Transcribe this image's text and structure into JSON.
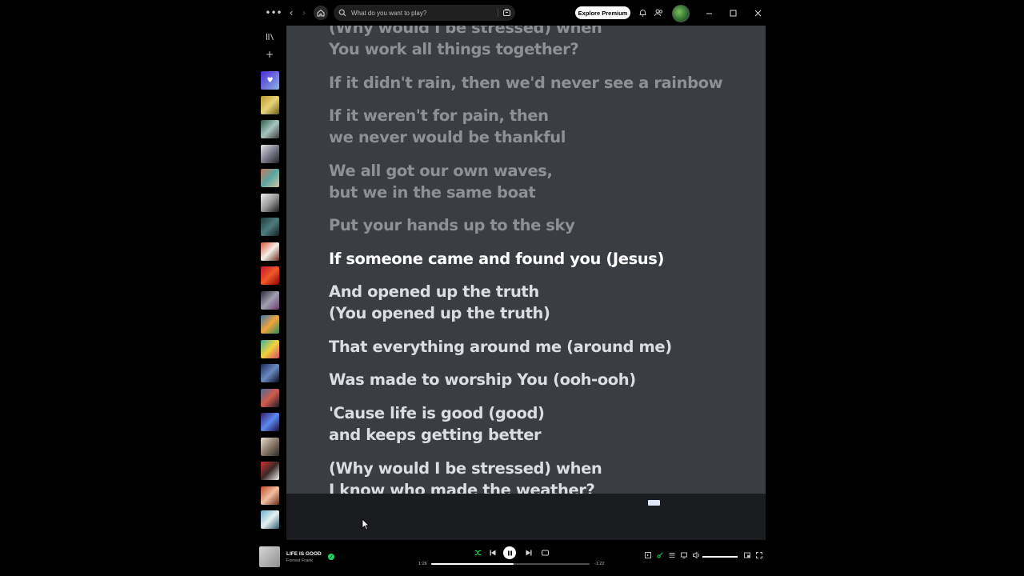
{
  "topbar": {
    "search_placeholder": "What do you want to play?",
    "premium_label": "Explore Premium"
  },
  "lyrics": {
    "lines": [
      {
        "text": "(Why would I be stressed) when",
        "state": "past"
      },
      {
        "text": "You work all things together?",
        "state": "past"
      },
      {
        "text": "If it didn't rain, then we'd never see a rainbow",
        "state": "past"
      },
      {
        "text": "If it weren't for pain, then",
        "state": "past"
      },
      {
        "text": "we never would be thankful",
        "state": "past"
      },
      {
        "text": "We all got our own waves,",
        "state": "past"
      },
      {
        "text": "but we in the same boat",
        "state": "past"
      },
      {
        "text": "Put your hands up to the sky",
        "state": "past"
      },
      {
        "text": "If someone came and found you (Jesus)",
        "state": "current"
      },
      {
        "text": "And opened up the truth",
        "state": "future"
      },
      {
        "text": "(You opened up the truth)",
        "state": "future"
      },
      {
        "text": "That everything around me (around me)",
        "state": "future"
      },
      {
        "text": "Was made to worship You (ooh-ooh)",
        "state": "future"
      },
      {
        "text": "'Cause life is good (good)",
        "state": "future"
      },
      {
        "text": "and keeps getting better",
        "state": "future"
      },
      {
        "text": "(Why would I be stressed) when",
        "state": "future"
      },
      {
        "text": "I know who made the weather?",
        "state": "future"
      }
    ]
  },
  "now_playing": {
    "title": "LIFE IS GOOD",
    "artist": "Forrest Frank",
    "elapsed": "1:26",
    "remaining": "-1:22",
    "progress_fraction": 0.52,
    "volume_fraction": 1.0
  },
  "colors": {
    "accent": "#1ed760",
    "lyrics_bg": "#3a3d42",
    "current_line": "#ffffff",
    "past_line": "#8d9196"
  },
  "icons": {
    "menu": "more-horizontal-icon",
    "back": "chevron-left-icon",
    "forward": "chevron-right-icon",
    "home": "home-icon",
    "search": "search-icon",
    "browse": "browse-icon",
    "bell": "bell-icon",
    "friends": "friends-icon",
    "minimize": "minimize-icon",
    "maximize": "maximize-icon",
    "close": "close-icon",
    "library": "library-icon",
    "add": "plus-icon",
    "shuffle": "shuffle-icon",
    "previous": "previous-icon",
    "pause": "pause-icon",
    "next": "next-icon",
    "repeat": "repeat-icon",
    "volume": "volume-icon"
  }
}
